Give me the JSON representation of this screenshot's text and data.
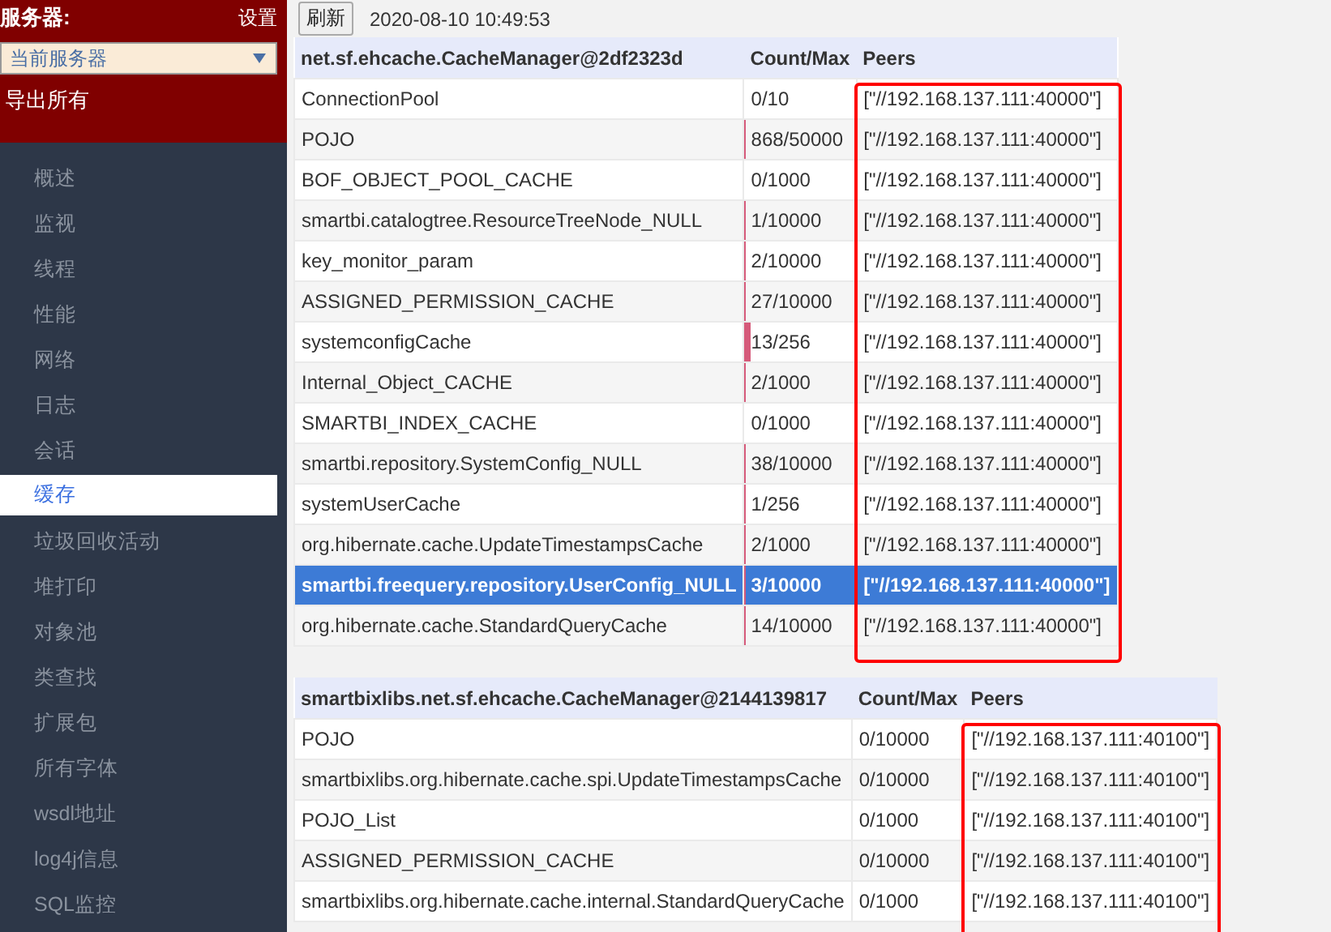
{
  "sidebar": {
    "server_label": "服务器:",
    "settings_link": "设置",
    "server_select": {
      "value": "当前服务器"
    },
    "export_all": "导出所有",
    "items": [
      {
        "label": "概述",
        "selected": false
      },
      {
        "label": "监视",
        "selected": false
      },
      {
        "label": "线程",
        "selected": false
      },
      {
        "label": "性能",
        "selected": false
      },
      {
        "label": "网络",
        "selected": false
      },
      {
        "label": "日志",
        "selected": false
      },
      {
        "label": "会话",
        "selected": false
      },
      {
        "label": "缓存",
        "selected": true
      },
      {
        "label": "垃圾回收活动",
        "selected": false
      },
      {
        "label": "堆打印",
        "selected": false
      },
      {
        "label": "对象池",
        "selected": false
      },
      {
        "label": "类查找",
        "selected": false
      },
      {
        "label": "扩展包",
        "selected": false
      },
      {
        "label": "所有字体",
        "selected": false
      },
      {
        "label": "wsdl地址",
        "selected": false
      },
      {
        "label": "log4j信息",
        "selected": false
      },
      {
        "label": "SQL监控",
        "selected": false
      }
    ]
  },
  "toolbar": {
    "refresh_button": "刷新",
    "timestamp": "2020-08-10 10:49:53"
  },
  "tables": [
    {
      "columns": [
        "net.sf.ehcache.CacheManager@2df2323d",
        "Count/Max",
        "Peers"
      ],
      "peers_highlighted": true,
      "rows": [
        {
          "name": "ConnectionPool",
          "count": "0/10",
          "peers": "[\"//192.168.137.111:40000\"]",
          "selected": false
        },
        {
          "name": "POJO",
          "count": "868/50000",
          "level": 0.017,
          "peers": "[\"//192.168.137.111:40000\"]",
          "selected": false
        },
        {
          "name": "BOF_OBJECT_POOL_CACHE",
          "count": "0/1000",
          "peers": "[\"//192.168.137.111:40000\"]",
          "selected": false
        },
        {
          "name": "smartbi.catalogtree.ResourceTreeNode_NULL",
          "count": "1/10000",
          "level": 0.0001,
          "peers": "[\"//192.168.137.111:40000\"]",
          "selected": false
        },
        {
          "name": "key_monitor_param",
          "count": "2/10000",
          "level": 0.0002,
          "peers": "[\"//192.168.137.111:40000\"]",
          "selected": false
        },
        {
          "name": "ASSIGNED_PERMISSION_CACHE",
          "count": "27/10000",
          "level": 0.0027,
          "peers": "[\"//192.168.137.111:40000\"]",
          "selected": false
        },
        {
          "name": "systemconfigCache",
          "count": "13/256",
          "level": 0.05,
          "peers": "[\"//192.168.137.111:40000\"]",
          "selected": false
        },
        {
          "name": "Internal_Object_CACHE",
          "count": "2/1000",
          "level": 0.002,
          "peers": "[\"//192.168.137.111:40000\"]",
          "selected": false
        },
        {
          "name": "SMARTBI_INDEX_CACHE",
          "count": "0/1000",
          "peers": "[\"//192.168.137.111:40000\"]",
          "selected": false
        },
        {
          "name": "smartbi.repository.SystemConfig_NULL",
          "count": "38/10000",
          "level": 0.0038,
          "peers": "[\"//192.168.137.111:40000\"]",
          "selected": false
        },
        {
          "name": "systemUserCache",
          "count": "1/256",
          "level": 0.004,
          "peers": "[\"//192.168.137.111:40000\"]",
          "selected": false
        },
        {
          "name": "org.hibernate.cache.UpdateTimestampsCache",
          "count": "2/1000",
          "level": 0.002,
          "peers": "[\"//192.168.137.111:40000\"]",
          "selected": false
        },
        {
          "name": "smartbi.freequery.repository.UserConfig_NULL",
          "count": "3/10000",
          "level": 0.0003,
          "peers": "[\"//192.168.137.111:40000\"]",
          "selected": true
        },
        {
          "name": "org.hibernate.cache.StandardQueryCache",
          "count": "14/10000",
          "level": 0.0014,
          "peers": "[\"//192.168.137.111:40000\"]",
          "selected": false
        }
      ]
    },
    {
      "columns": [
        "smartbixlibs.net.sf.ehcache.CacheManager@2144139817",
        "Count/Max",
        "Peers"
      ],
      "peers_highlighted": true,
      "rows": [
        {
          "name": "POJO",
          "count": "0/10000",
          "peers": "[\"//192.168.137.111:40100\"]",
          "selected": false
        },
        {
          "name": "smartbixlibs.org.hibernate.cache.spi.UpdateTimestampsCache",
          "count": "0/10000",
          "peers": "[\"//192.168.137.111:40100\"]",
          "selected": false
        },
        {
          "name": "POJO_List",
          "count": "0/1000",
          "peers": "[\"//192.168.137.111:40100\"]",
          "selected": false
        },
        {
          "name": "ASSIGNED_PERMISSION_CACHE",
          "count": "0/10000",
          "peers": "[\"//192.168.137.111:40100\"]",
          "selected": false
        },
        {
          "name": "smartbixlibs.org.hibernate.cache.internal.StandardQueryCache",
          "count": "0/1000",
          "peers": "[\"//192.168.137.111:40100\"]",
          "selected": false
        }
      ]
    }
  ]
}
